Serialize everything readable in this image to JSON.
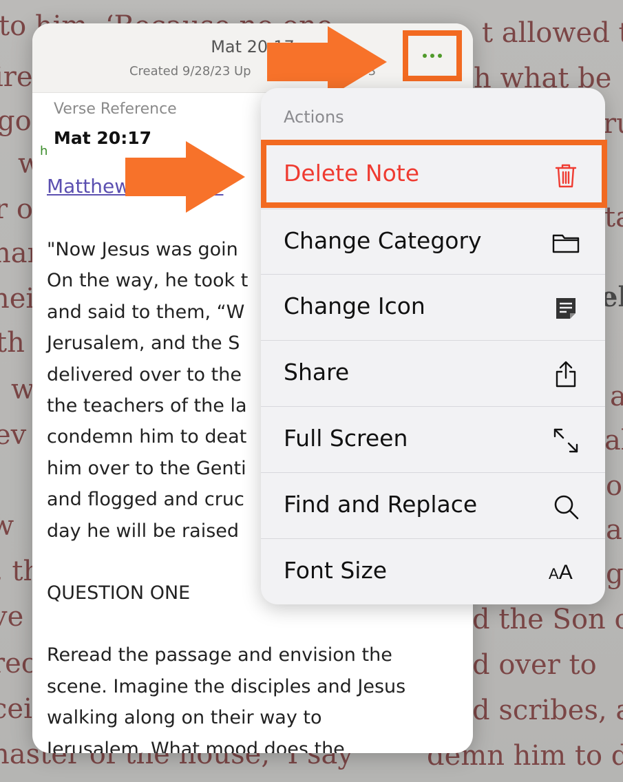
{
  "background_text": {
    "lines": [
      "to him, ‘Because no one",
      "t allowed to",
      "ire",
      "h what be",
      "go",
      "ru",
      "w",
      "r o",
      "ta",
      "nar",
      "hei",
      "el",
      "th",
      "w",
      "a",
      "ev",
      "al",
      "ol",
      "w",
      "ai",
      ", th",
      "g",
      "ve",
      "d the Son of",
      "rec",
      "d over to",
      "cei",
      "d scribes, a",
      "naster of the house, ‘I say",
      "demn him to d"
    ]
  },
  "note": {
    "title": "Mat 20:17",
    "subtitle": "Created 9/28/23 Up",
    "subtitle_end": "3",
    "reference_label": "Verse Reference",
    "reference_value": "Mat 20:17",
    "marker": "h",
    "reference_link": "Matthew 20:17-19",
    "body": [
      "\"Now Jesus was goin",
      "On the way, he took t",
      "and said to them, “W",
      "Jerusalem, and the S",
      "delivered over to the",
      "the teachers of the la",
      "condemn him to deat",
      "him over to the Genti",
      "and flogged and cruc",
      "day he will be raised",
      "",
      "QUESTION ONE",
      "",
      "Reread the passage and envision the",
      "scene. Imagine the disciples and Jesus",
      "walking along on their way to",
      "Jerusalem. What mood does the"
    ]
  },
  "menu": {
    "header": "Actions",
    "items": [
      {
        "label": "Delete Note",
        "icon": "trash-icon",
        "destructive": true
      },
      {
        "label": "Change Category",
        "icon": "folder-icon"
      },
      {
        "label": "Change Icon",
        "icon": "note-icon"
      },
      {
        "label": "Share",
        "icon": "share-icon"
      },
      {
        "label": "Full Screen",
        "icon": "expand-icon"
      },
      {
        "label": "Find and Replace",
        "icon": "search-icon"
      },
      {
        "label": "Font Size",
        "icon": "font-size-icon",
        "icon_text": "AA"
      }
    ]
  },
  "colors": {
    "highlight": "#f26a21",
    "destructive": "#ef3b31",
    "accent_green": "#4f9a2a",
    "link": "#5b4fb0",
    "background_text": "#6e1c1c"
  }
}
